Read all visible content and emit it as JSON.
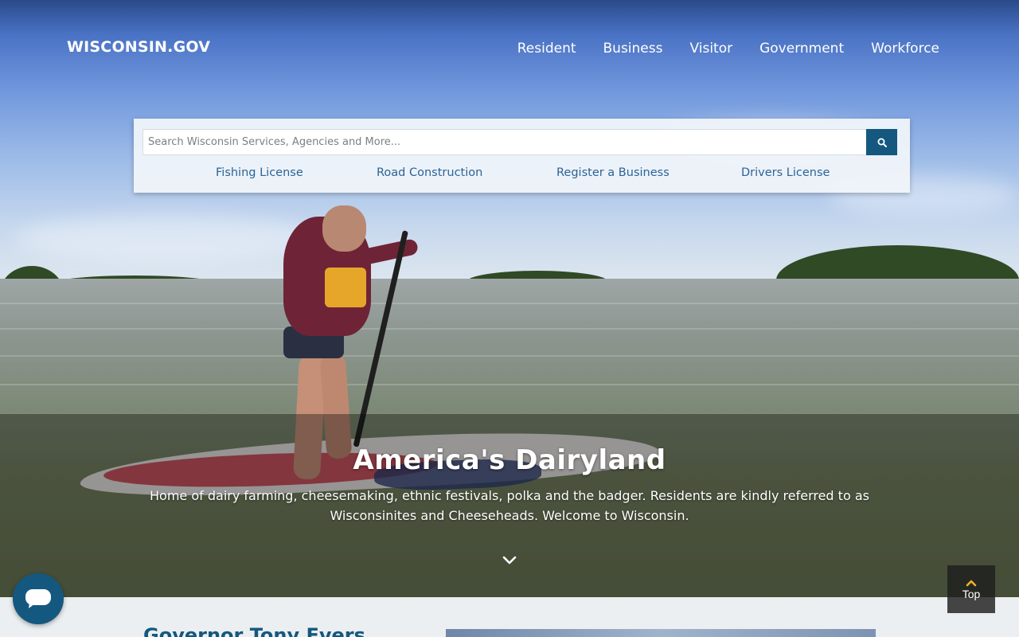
{
  "header": {
    "logo": "WISCONSIN.GOV",
    "nav": [
      "Resident",
      "Business",
      "Visitor",
      "Government",
      "Workforce"
    ]
  },
  "search": {
    "placeholder": "Search Wisconsin Services, Agencies and More...",
    "button_icon": "search-icon",
    "quick_links": [
      "Fishing License",
      "Road Construction",
      "Register a Business",
      "Drivers License"
    ]
  },
  "hero": {
    "title": "America's Dairyland",
    "description": "Home of dairy farming, cheesemaking, ethnic festivals, polka and the badger. Residents are kindly referred to as Wisconsinites and Cheeseheads. Welcome to Wisconsin.",
    "scroll_icon": "chevron-down-icon"
  },
  "chat": {
    "icon": "chat-bubble-icon"
  },
  "back_to_top": {
    "label": "Top",
    "icon": "chevron-up-icon"
  },
  "below_fold": {
    "heading": "Governor Tony Evers"
  },
  "colors": {
    "brand_blue": "#14587f",
    "link_blue": "#2a6496",
    "panel_bg": "#f0f4fa"
  }
}
